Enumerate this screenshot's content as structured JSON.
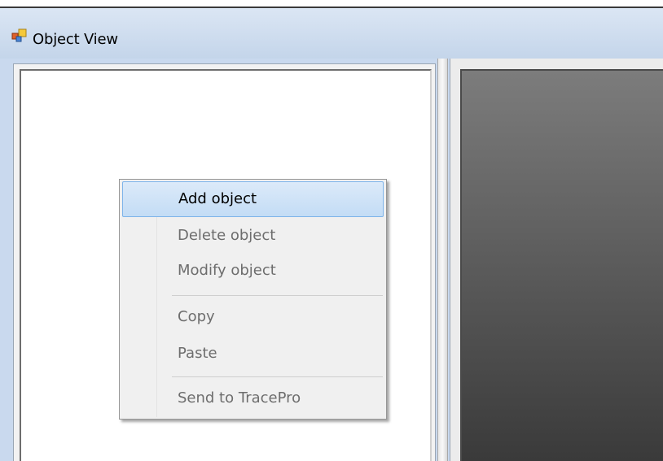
{
  "window": {
    "title": "Object View",
    "icon": "window-app-icon"
  },
  "context_menu": {
    "items": [
      {
        "label": "Add object",
        "enabled": true,
        "highlighted": true
      },
      {
        "label": "Delete object",
        "enabled": false
      },
      {
        "label": "Modify object",
        "enabled": false
      },
      {
        "label": "Copy",
        "enabled": false
      },
      {
        "label": "Paste",
        "enabled": false
      },
      {
        "label": "Send to TracePro",
        "enabled": false
      }
    ]
  },
  "colors": {
    "titlebar": "#c9d9ee",
    "menu_highlight": "#c3dcf5",
    "viewport_top": "#7c7c7c",
    "viewport_bottom": "#3a3a3a"
  }
}
